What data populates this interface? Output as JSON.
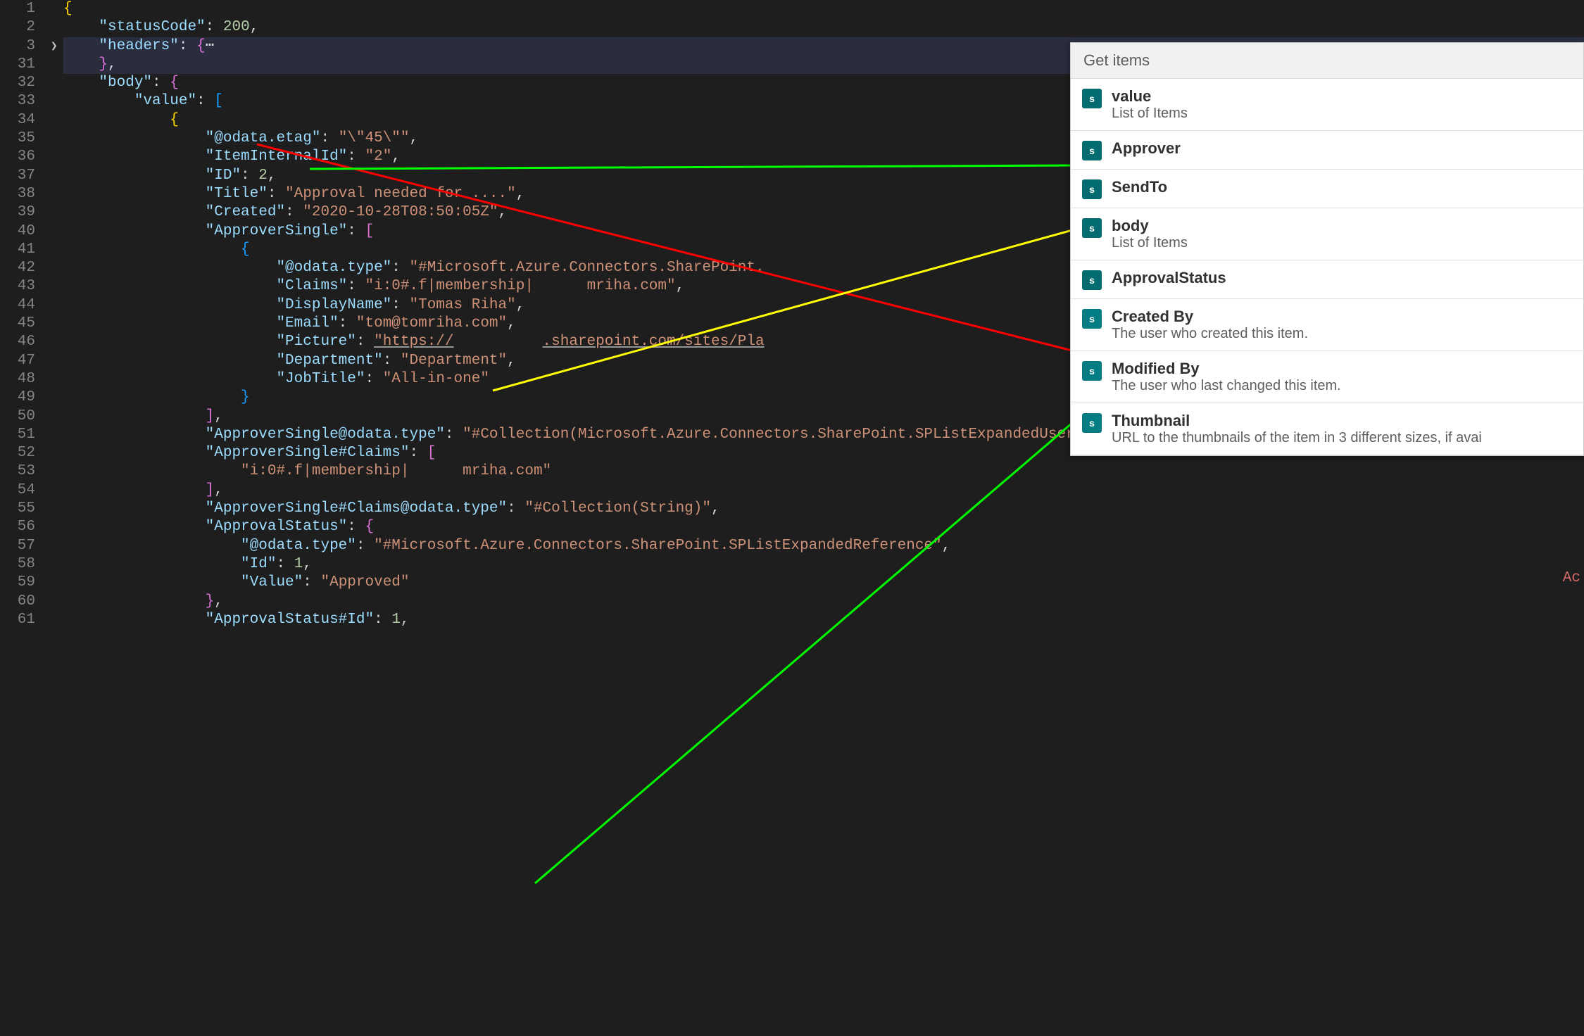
{
  "lineNumbers": [
    "1",
    "2",
    "3",
    "31",
    "32",
    "33",
    "34",
    "35",
    "36",
    "37",
    "38",
    "39",
    "40",
    "41",
    "42",
    "43",
    "44",
    "45",
    "46",
    "47",
    "48",
    "49",
    "50",
    "51",
    "52",
    "53",
    "54",
    "55",
    "56",
    "57",
    "58",
    "59",
    "60",
    "61"
  ],
  "code": {
    "statusCode": "\"statusCode\"",
    "statusCodeVal": "200",
    "headers": "\"headers\"",
    "body": "\"body\"",
    "value": "\"value\"",
    "odataEtag": "\"@odata.etag\"",
    "odataEtagVal": "\"\\\"45\\\"\"",
    "itemInternalId": "\"ItemInternalId\"",
    "itemInternalIdVal": "\"2\"",
    "id": "\"ID\"",
    "idVal": "2",
    "title": "\"Title\"",
    "titleVal": "\"Approval needed for ....\"",
    "created": "\"Created\"",
    "createdVal": "\"2020-10-28T08:50:05Z\"",
    "approverSingle": "\"ApproverSingle\"",
    "odataType": "\"@odata.type\"",
    "odataTypeVal": "\"#Microsoft.Azure.Connectors.SharePoint.",
    "claims": "\"Claims\"",
    "claimsVal1": "\"i:0#.f|membership|",
    "claimsVal2": "mriha.com\"",
    "displayName": "\"DisplayName\"",
    "displayNameVal": "\"Tomas Riha\"",
    "email": "\"Email\"",
    "emailVal": "\"tom@tomriha.com\"",
    "picture": "\"Picture\"",
    "pictureVal1": "\"https://",
    "pictureVal2": ".sharepoint.com/sites/Pla",
    "department": "\"Department\"",
    "departmentVal": "\"Department\"",
    "jobTitle": "\"JobTitle\"",
    "jobTitleVal": "\"All-in-one\"",
    "approverSingleOdataType": "\"ApproverSingle@odata.type\"",
    "approverSingleOdataTypeVal": "\"#Collection(Microsoft.Azure.Connectors.SharePoint.SPListExpandedUser)\"",
    "approverSingleClaims": "\"ApproverSingle#Claims\"",
    "approverSingleClaimsVal1": "\"i:0#.f|membership|",
    "approverSingleClaimsVal2": "mriha.com\"",
    "approverSingleClaimsOdataType": "\"ApproverSingle#Claims@odata.type\"",
    "approverSingleClaimsOdataTypeVal": "\"#Collection(String)\"",
    "approvalStatus": "\"ApprovalStatus\"",
    "approvalStatusOdataTypeVal": "\"#Microsoft.Azure.Connectors.SharePoint.SPListExpandedReference\"",
    "approvalStatusId": "\"Id\"",
    "approvalStatusIdVal": "1",
    "approvalStatusValue": "\"Value\"",
    "approvalStatusValueVal": "\"Approved\"",
    "approvalStatusHashId": "\"ApprovalStatus#Id\"",
    "approvalStatusHashIdVal": "1",
    "ellipsis": "⋯",
    "redText": "Ac"
  },
  "panel": {
    "header": "Get items",
    "items": [
      {
        "title": "value",
        "subtitle": "List of Items"
      },
      {
        "title": "Approver",
        "subtitle": ""
      },
      {
        "title": "SendTo",
        "subtitle": ""
      },
      {
        "title": "body",
        "subtitle": "List of Items"
      },
      {
        "title": "ApprovalStatus",
        "subtitle": ""
      },
      {
        "title": "Created By",
        "subtitle": "The user who created this item."
      },
      {
        "title": "Modified By",
        "subtitle": "The user who last changed this item."
      },
      {
        "title": "Thumbnail",
        "subtitle": "URL to the thumbnails of the item in 3 different sizes, if avai"
      }
    ]
  }
}
